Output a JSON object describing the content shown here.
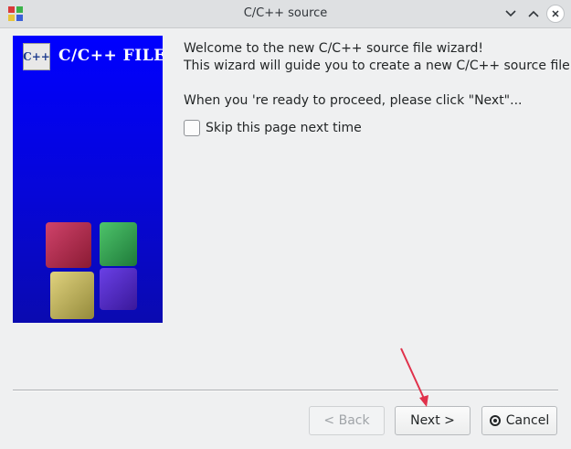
{
  "window": {
    "title": "C/C++ source"
  },
  "banner": {
    "title": "C/C++ FILE",
    "icon_text": "C++"
  },
  "content": {
    "line1": "Welcome to the new C/C++ source file wizard!",
    "line2": "This wizard will guide you to create a new C/C++ source file.",
    "line3": "When you 're ready to proceed, please click \"Next\"...",
    "skip_label": "Skip this page next time",
    "skip_checked": false
  },
  "buttons": {
    "back": "< Back",
    "next": "Next >",
    "cancel": "Cancel"
  },
  "colors": {
    "banner_blue": "#0000ff",
    "annotation_arrow": "#e0314b"
  },
  "icons": {
    "app": "codeblocks-icon",
    "minimize": "chevron-down-icon",
    "maximize": "chevron-up-icon",
    "close": "close-icon",
    "cancel": "cancel-circle-icon",
    "annotation": "arrow-icon"
  }
}
